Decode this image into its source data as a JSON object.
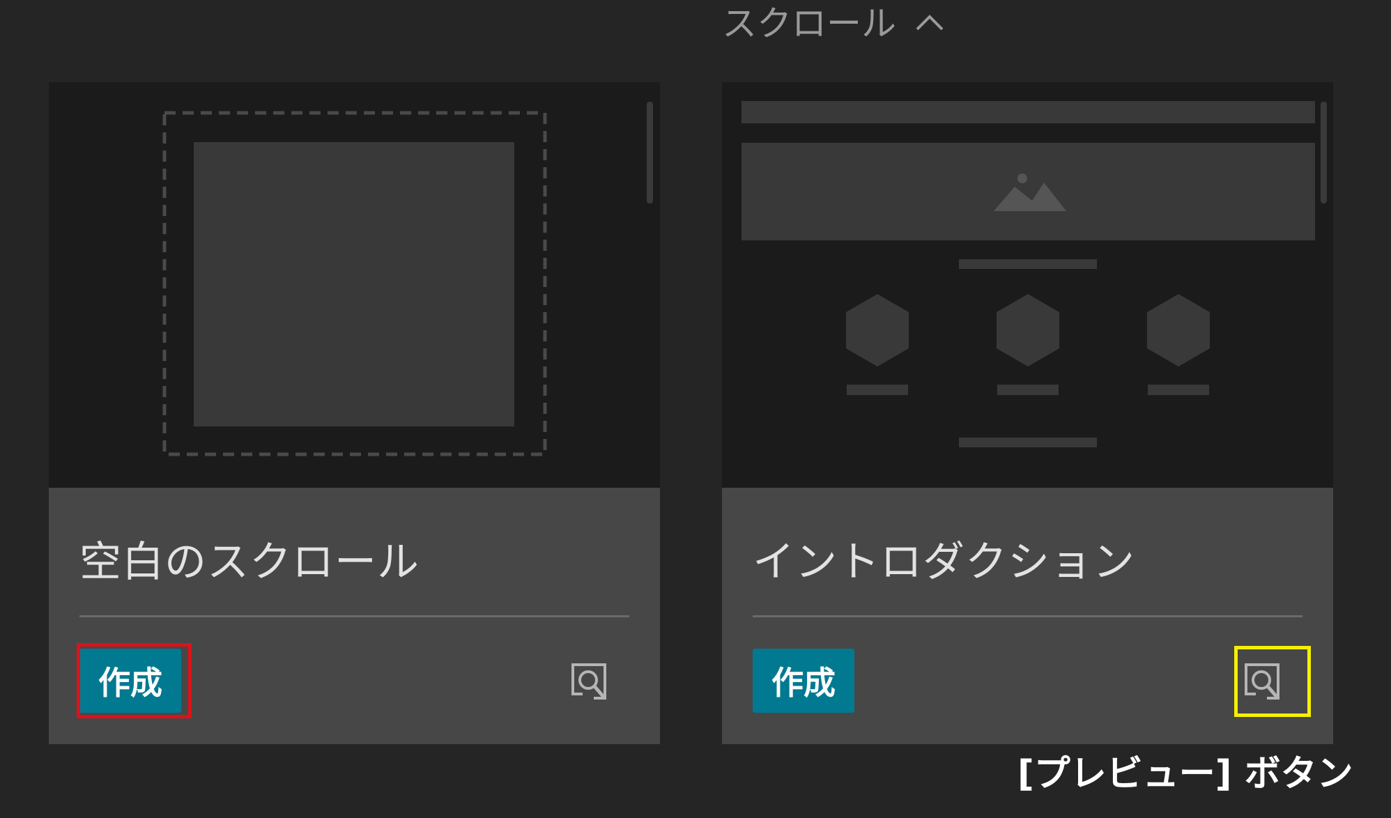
{
  "section": {
    "label": "スクロール",
    "toggle_icon": "chevron-up-icon"
  },
  "cards": [
    {
      "title": "空白のスクロール",
      "create_label": "作成",
      "preview_icon": "preview-search-icon",
      "thumbnail": "blank-scroll-thumbnail"
    },
    {
      "title": "イントロダクション",
      "create_label": "作成",
      "preview_icon": "preview-search-icon",
      "thumbnail": "introduction-thumbnail"
    }
  ],
  "annotation": {
    "callout": "[プレビュー] ボタン",
    "red_highlight": "#e0101a",
    "yellow_highlight": "#f5f000"
  },
  "colors": {
    "background": "#252525",
    "card": "#474747",
    "thumbnail": "#1b1b1b",
    "create_button": "#017a91"
  }
}
